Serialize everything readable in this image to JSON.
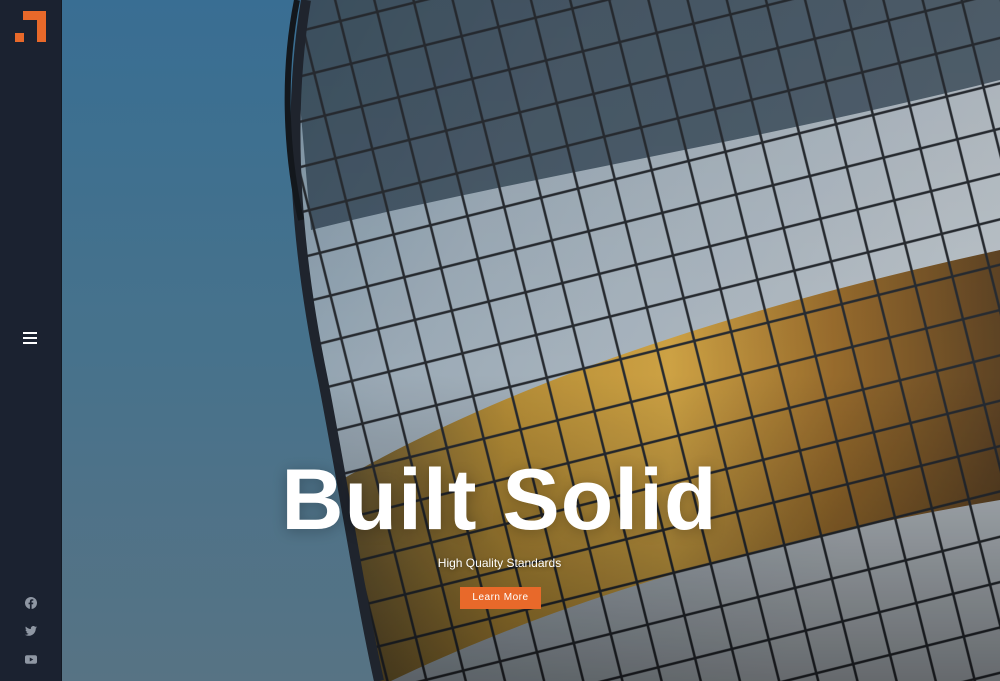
{
  "brand": {
    "logo_icon": "stair-step-logo-icon",
    "accent_color": "#e8692a"
  },
  "sidebar": {
    "menu_icon": "hamburger-menu-icon",
    "social": [
      {
        "name": "facebook",
        "icon": "facebook-icon"
      },
      {
        "name": "twitter",
        "icon": "twitter-icon"
      },
      {
        "name": "youtube",
        "icon": "youtube-icon"
      }
    ]
  },
  "hero": {
    "title": "Built Solid",
    "subtitle": "High Quality Standards",
    "cta_label": "Learn More",
    "background": "curved-glass-building-photo"
  }
}
